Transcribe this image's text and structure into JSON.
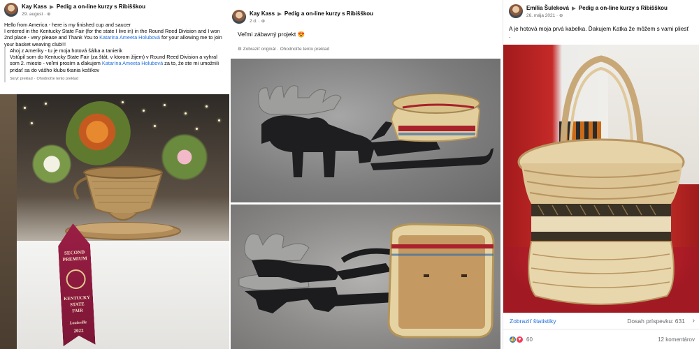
{
  "post1": {
    "author": "Kay Kass",
    "group": "Pedig a on-line kurzy s Ribišškou",
    "date": "29. august",
    "text_parts": [
      "Hello from America - here is my finished cup and saucer",
      "I entered in the Kentucky State Fair (for the state I live in) in the Round Reed Division and I won 2nd place - very please and Thank You to ",
      "Katarina Ameeta Holubová",
      " for your allowing me to join your basket weaving club!!!"
    ],
    "translation_parts": [
      "Ahoj z Ameriky - tu je moja hotová šálka a tanierik",
      "Vstúpil som do Kentucky State Fair (za štát, v ktorom žijem) v Round Reed Division a vyhral som 2. miesto - veľmi prosím a ďakujem ",
      "Katarína Ameeta Holubová",
      " za to, že ste mi umožnili pridať sa do vášho klubu tkania košíkov"
    ],
    "hide_translation": "Skryť preklad",
    "rate_translation": "Ohodnoťte tento preklad",
    "ribbon": {
      "line1": "SECOND",
      "line2": "PREMIUM",
      "line3": "KENTUCKY",
      "line4": "STATE",
      "line5": "FAIR",
      "line6": "Louisville",
      "line7": "2022"
    }
  },
  "post2": {
    "author": "Kay Kass",
    "group": "Pedig a on-line kurzy s Ribišškou",
    "date": "2 d.",
    "text": "Veľmi zábavný projekt",
    "emoji": "😍",
    "show_original": "Zobraziť originál",
    "rate_translation": "Ohodnoťte tento preklad"
  },
  "post3": {
    "author": "Emília Šuleková",
    "group": "Pedig a on-line kurzy s Ribišškou",
    "date": "26. mája 2021",
    "text": "A je hotová moja prvá kabelka. Ďakujem Katka že môžem s vami pliesť",
    "text_tail": ".",
    "stats_link": "Zobraziť štatistiky",
    "reach_label": "Dosah príspevku: 631",
    "reactions_count": "60",
    "comments_count": "12 komentárov"
  },
  "colors": {
    "link": "#216fdb",
    "muted": "#65676b",
    "like": "#1877f2",
    "love": "#f33e58"
  },
  "icons": [
    "globe-icon",
    "chevron-right-icon",
    "like-reaction-icon",
    "love-reaction-icon"
  ]
}
